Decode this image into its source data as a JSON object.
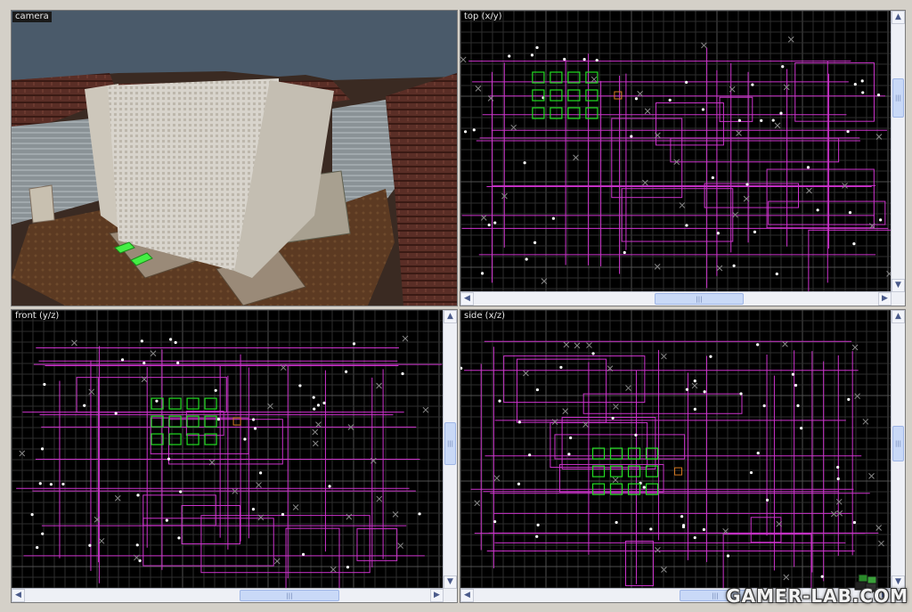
{
  "viewports": {
    "camera": {
      "label": "camera"
    },
    "top": {
      "label": "top (x/y)"
    },
    "front": {
      "label": "front (y/z)"
    },
    "side": {
      "label": "side (x/z)"
    }
  },
  "scrollbar_glyphs": {
    "up": "▲",
    "down": "▼",
    "left": "◀",
    "right": "▶",
    "grip": "|||"
  },
  "colors": {
    "grid_minor": "#2e2e2e",
    "grid_major": "#505050",
    "brush": "#cc33cc",
    "entity": "#22dd22",
    "point": "#888888",
    "selected": "#d67a20",
    "sky": "#4a5a6a"
  },
  "watermark": {
    "text": "GAMER-LAB.COM"
  }
}
